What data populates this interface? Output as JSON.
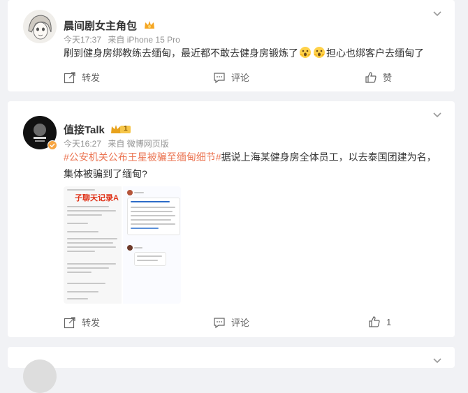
{
  "posts": [
    {
      "username": "晨间剧女主角包",
      "time": "今天17:37",
      "source": "来自 iPhone 15 Pro",
      "text_part1": "刷到健身房绑教练去缅甸，最近都不敢去健身房锻炼了",
      "text_part2": "担心也绑客户去缅甸了",
      "actions": {
        "repost": "转发",
        "comment": "评论",
        "like": "赞"
      }
    },
    {
      "username": "值接Talk",
      "level_badge": "1",
      "time": "今天16:27",
      "source": "来自 微博网页版",
      "topic": "#公安机关公布王星被骗至缅甸细节#",
      "text_line1_rest": "据说上海某健身房全体员工，以去泰国团建为名，",
      "text_line2": "集体被骗到了缅甸?",
      "image_title": "子聊天记录A",
      "actions": {
        "repost": "转发",
        "comment": "评论",
        "like_count": "1"
      }
    }
  ],
  "colors": {
    "topic": "#eb7350",
    "meta": "#939393",
    "background": "#f1f2f5"
  }
}
